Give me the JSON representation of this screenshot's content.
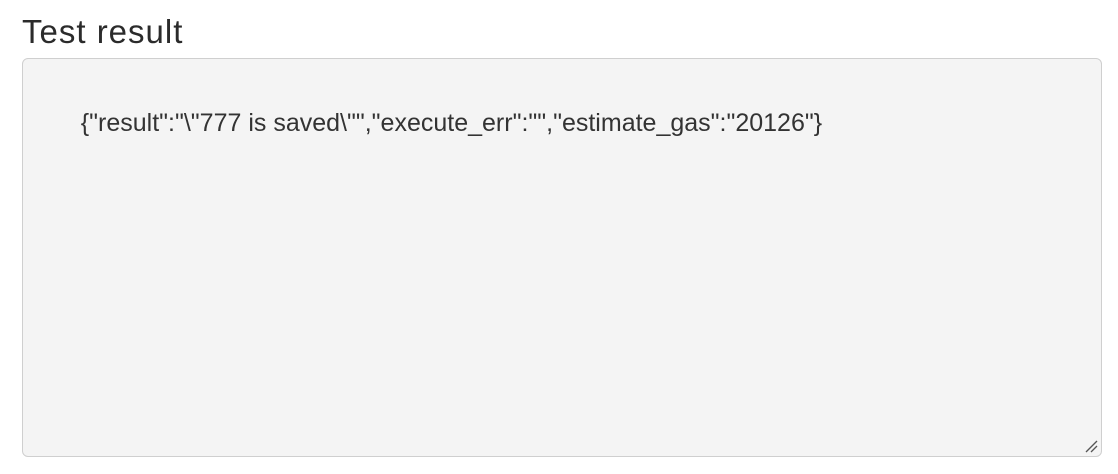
{
  "section": {
    "title": "Test result"
  },
  "result_box": {
    "value": "{\"result\":\"\\\"777 is saved\\\"\",\"execute_err\":\"\",\"estimate_gas\":\"20126\"}"
  },
  "icons": {
    "resize": "resize-grip-icon"
  }
}
